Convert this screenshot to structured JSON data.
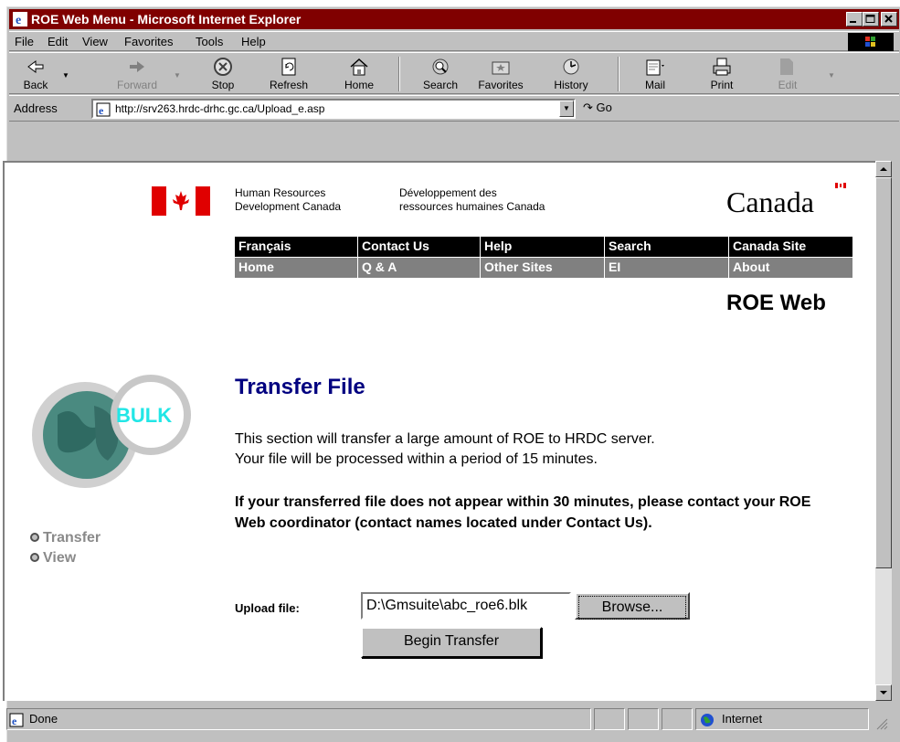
{
  "window": {
    "title": "ROE Web Menu - Microsoft Internet Explorer"
  },
  "menu": [
    "File",
    "Edit",
    "View",
    "Favorites",
    "Tools",
    "Help"
  ],
  "toolbar": {
    "back": "Back",
    "forward": "Forward",
    "stop": "Stop",
    "refresh": "Refresh",
    "home": "Home",
    "search": "Search",
    "favorites": "Favorites",
    "history": "History",
    "mail": "Mail",
    "print": "Print",
    "edit": "Edit"
  },
  "address": {
    "label": "Address",
    "url": "http://srv263.hrdc-drhc.gc.ca/Upload_e.asp",
    "go": "Go"
  },
  "header": {
    "dept_en_line1": "Human Resources",
    "dept_en_line2": "Development Canada",
    "dept_fr_line1": "Développement des",
    "dept_fr_line2": "ressources humaines Canada",
    "wordmark": "Canada"
  },
  "nav": {
    "row1": [
      "Français",
      "Contact Us",
      "Help",
      "Search",
      "Canada Site"
    ],
    "row2": [
      "Home",
      "Q & A",
      "Other Sites",
      "EI",
      "About"
    ]
  },
  "app_title": "ROE Web",
  "logo_text": "BULK",
  "sidenav": [
    "Transfer",
    "View"
  ],
  "main": {
    "heading": "Transfer File",
    "para1_line1": "This section will transfer a large amount of ROE to HRDC server.",
    "para1_line2": "Your file will be processed within a period of 15 minutes.",
    "para2": "If your transferred file does not appear within 30 minutes, please contact your ROE Web coordinator (contact names located under Contact Us).",
    "upload_label": "Upload file:",
    "upload_value": "D:\\Gmsuite\\abc_roe6.blk",
    "browse_label": "Browse...",
    "submit_label": "Begin Transfer"
  },
  "status": {
    "text": "Done",
    "zone": "Internet"
  },
  "colors": {
    "titlebar": "#800000",
    "heading": "#000080",
    "nav_row1": "#000000",
    "nav_row2": "#808080"
  }
}
